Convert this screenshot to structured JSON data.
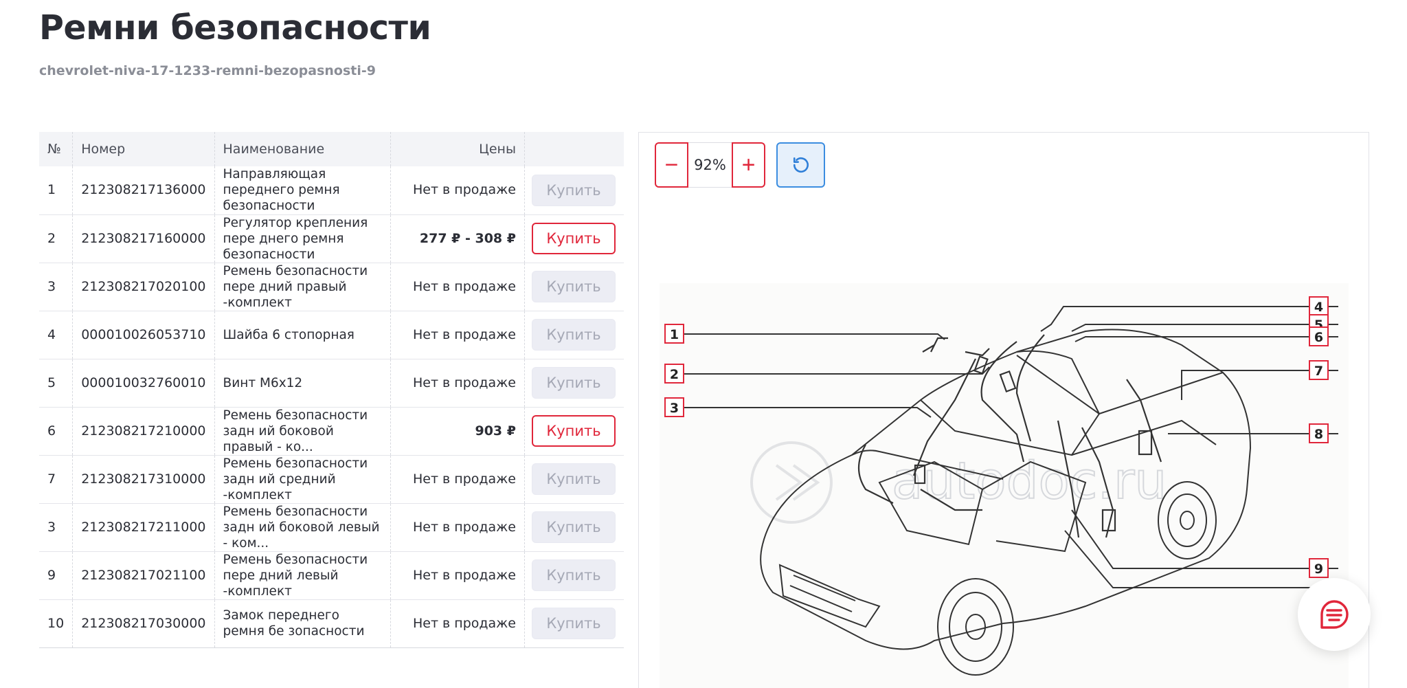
{
  "page": {
    "title": "Ремни безопасности",
    "slug": "chevrolet-niva-17-1233-remni-bezopasnosti-9"
  },
  "table": {
    "headers": {
      "n": "№",
      "number": "Номер",
      "name": "Наименование",
      "price": "Цены",
      "buy": ""
    },
    "rows": [
      {
        "n": "1",
        "number": "212308217136000",
        "name": "Направляющая переднего ремня безопасности",
        "price": "Нет в продаже",
        "buy": "Купить"
      },
      {
        "n": "2",
        "number": "212308217160000",
        "name": "Регулятор крепления пере днего ремня безопасности",
        "price": "277 ₽ - 308 ₽",
        "buy": "Купить"
      },
      {
        "n": "3",
        "number": "212308217020100",
        "name": "Ремень безопасности пере дний правый -комплект",
        "price": "Нет в продаже",
        "buy": "Купить"
      },
      {
        "n": "4",
        "number": "000010026053710",
        "name": "Шайба 6 стопорная",
        "price": "Нет в продаже",
        "buy": "Купить"
      },
      {
        "n": "5",
        "number": "000010032760010",
        "name": "Винт М6х12",
        "price": "Нет в продаже",
        "buy": "Купить"
      },
      {
        "n": "6",
        "number": "212308217210000",
        "name": "Ремень безопасности задн ий боковой правый - ко...",
        "price": "903 ₽",
        "buy": "Купить"
      },
      {
        "n": "7",
        "number": "212308217310000",
        "name": "Ремень безопасности задн ий средний -комплект",
        "price": "Нет в продаже",
        "buy": "Купить"
      },
      {
        "n": "3",
        "number": "212308217211000",
        "name": "Ремень безопасности задн ий боковой левый - ком...",
        "price": "Нет в продаже",
        "buy": "Купить"
      },
      {
        "n": "9",
        "number": "212308217021100",
        "name": "Ремень безопасности пере дний левый -комплект",
        "price": "Нет в продаже",
        "buy": "Купить"
      },
      {
        "n": "10",
        "number": "212308217030000",
        "name": "Замок переднего ремня бе зопасности",
        "price": "Нет в продаже",
        "buy": "Купить"
      }
    ]
  },
  "viewer": {
    "zoom_minus": "−",
    "zoom_value": "92%",
    "zoom_plus": "+",
    "reset_icon": "rotate-ccw-icon",
    "watermark_text": "autodoc.ru",
    "callouts": [
      "1",
      "2",
      "3",
      "4",
      "5",
      "6",
      "7",
      "8",
      "9"
    ]
  },
  "fab": {
    "icon": "chat-menu-icon"
  },
  "colors": {
    "accent": "#e0263a",
    "blue": "#3b8de0",
    "text": "#2b2d35",
    "muted": "#8a8d96"
  }
}
